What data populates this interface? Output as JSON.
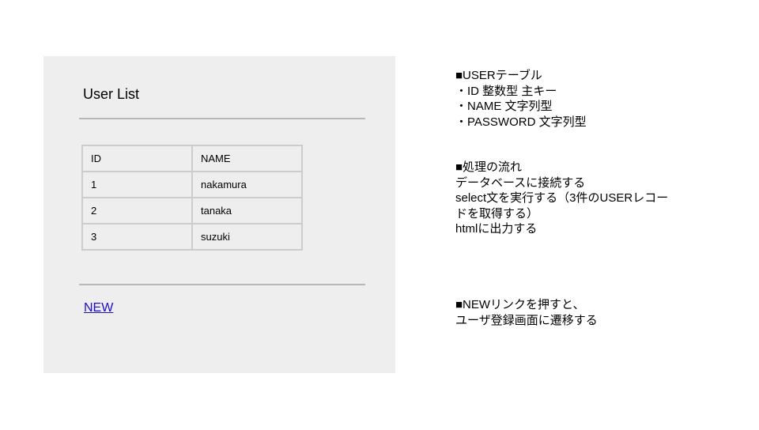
{
  "panel": {
    "title": "User List",
    "table": {
      "headers": [
        "ID",
        "NAME"
      ],
      "rows": [
        [
          "1",
          "nakamura"
        ],
        [
          "2",
          "tanaka"
        ],
        [
          "3",
          "suzuki"
        ]
      ]
    },
    "new_link": "NEW"
  },
  "notes": {
    "user_table": [
      "■USERテーブル",
      "・ID 整数型 主キー",
      "・NAME 文字列型",
      "・PASSWORD 文字列型"
    ],
    "process_flow": [
      "■処理の流れ",
      "データベースに接続する",
      "select文を実行する（3件のUSERレコー",
      "ドを取得する）",
      "htmlに出力する"
    ],
    "new_link_note": [
      "■NEWリンクを押すと、",
      "ユーザ登録画面に遷移する"
    ]
  },
  "colors": {
    "panel_background": "#eeeeee",
    "rule": "#b7b7b7",
    "table_border": "#cccccc",
    "link": "#1a0dcc"
  }
}
